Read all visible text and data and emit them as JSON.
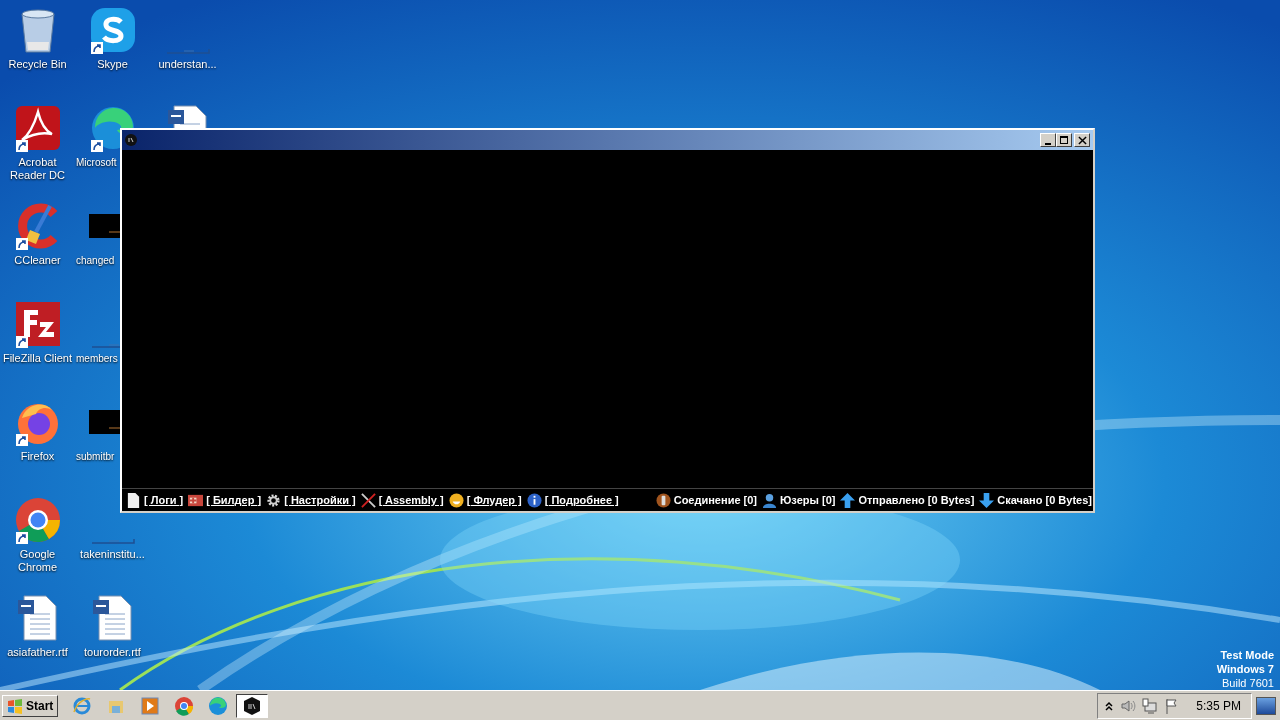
{
  "desktop": {
    "icons": [
      {
        "kind": "recycle-bin",
        "shortcut": false,
        "label": "Recycle Bin"
      },
      {
        "kind": "pdf",
        "shortcut": true,
        "label": "Acrobat Reader DC"
      },
      {
        "kind": "ccleaner",
        "shortcut": true,
        "label": "CCleaner"
      },
      {
        "kind": "filezilla",
        "shortcut": true,
        "label": "FileZilla Client"
      },
      {
        "kind": "firefox",
        "shortcut": true,
        "label": "Firefox"
      },
      {
        "kind": "chrome",
        "shortcut": true,
        "label": "Google Chrome"
      },
      {
        "kind": "word",
        "shortcut": false,
        "label": "asiafather.rtf"
      },
      {
        "kind": "skype",
        "shortcut": true,
        "label": "Skype"
      },
      {
        "kind": "edge",
        "shortcut": true,
        "label": "Microsoft"
      },
      {
        "kind": "dark-file",
        "shortcut": false,
        "label": "changed"
      },
      {
        "kind": "blank-file",
        "shortcut": false,
        "label": "members"
      },
      {
        "kind": "dark-file",
        "shortcut": false,
        "label": "submitbr"
      },
      {
        "kind": "blank-file",
        "shortcut": false,
        "label": "takeninstitu..."
      },
      {
        "kind": "word",
        "shortcut": false,
        "label": "tourorder.rtf"
      },
      {
        "kind": "blank-file",
        "shortcut": false,
        "label": "understan..."
      },
      {
        "kind": "word",
        "shortcut": false
      }
    ]
  },
  "window": {
    "menu": [
      {
        "kind": "file",
        "label": "[ Логи ]"
      },
      {
        "kind": "builder",
        "label": "[ Билдер ]"
      },
      {
        "kind": "gear",
        "label": "[ Настройки ]"
      },
      {
        "kind": "tools",
        "label": "[ Assembly ]"
      },
      {
        "kind": "smiley",
        "label": "[ Флудер ]"
      },
      {
        "kind": "info",
        "label": "[ Подробнее ]"
      }
    ],
    "status": [
      {
        "kind": "phone",
        "label": "Соединение [0]"
      },
      {
        "kind": "user",
        "label": "Юзеры [0]"
      },
      {
        "kind": "up",
        "label": "Отправлено [0 Bytes]"
      },
      {
        "kind": "down",
        "label": "Скачано [0 Bytes]"
      }
    ]
  },
  "watermark_lines": [
    "Test Mode",
    "Windows 7",
    "Build 7601"
  ],
  "taskbar": {
    "start": "Start",
    "apps": [
      {
        "kind": "ie",
        "selected": false
      },
      {
        "kind": "explorer",
        "selected": false
      },
      {
        "kind": "media",
        "selected": false
      },
      {
        "kind": "chrome",
        "selected": false
      },
      {
        "kind": "edge",
        "selected": false
      },
      {
        "kind": "app",
        "selected": true
      }
    ],
    "clock": "5:35 PM"
  }
}
